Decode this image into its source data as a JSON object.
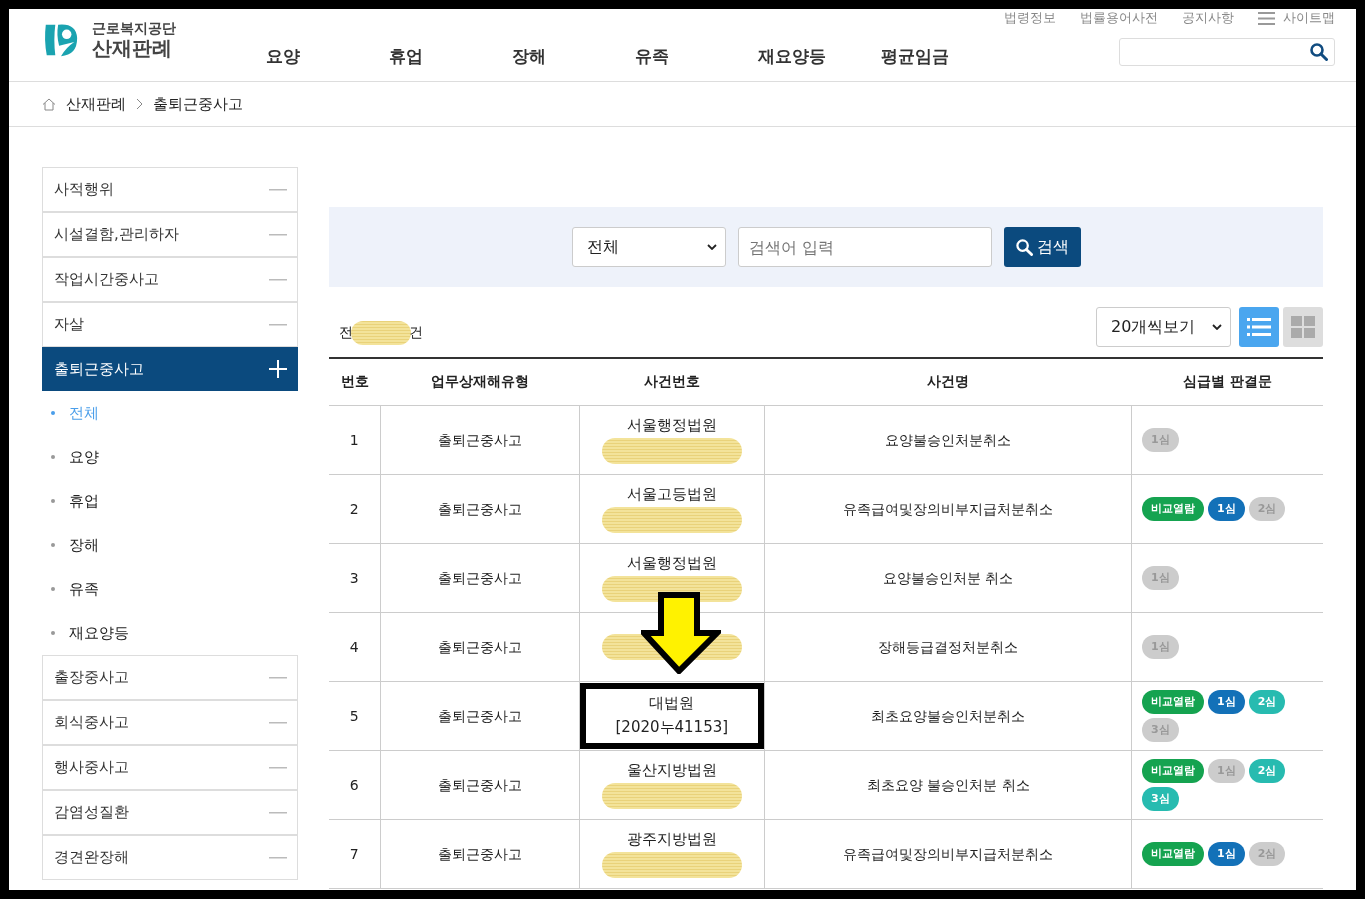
{
  "logo": {
    "org": "근로복지공단",
    "title": "산재판례"
  },
  "nav": [
    "요양",
    "휴업",
    "장해",
    "유족",
    "재요양등",
    "평균임금"
  ],
  "utility_links": [
    "법령정보",
    "법률용어사전",
    "공지사항"
  ],
  "sitemap": "사이트맵",
  "breadcrumb": [
    "산재판례",
    "출퇴근중사고"
  ],
  "sidebar": [
    {
      "label": "사적행위",
      "expanded": false
    },
    {
      "label": "시설결함,관리하자",
      "expanded": false
    },
    {
      "label": "작업시간중사고",
      "expanded": false
    },
    {
      "label": "자살",
      "expanded": false
    },
    {
      "label": "출퇴근중사고",
      "expanded": true,
      "children": [
        {
          "label": "전체",
          "selected": true
        },
        {
          "label": "요양",
          "selected": false
        },
        {
          "label": "휴업",
          "selected": false
        },
        {
          "label": "장해",
          "selected": false
        },
        {
          "label": "유족",
          "selected": false
        },
        {
          "label": "재요양등",
          "selected": false
        }
      ]
    },
    {
      "label": "출장중사고",
      "expanded": false
    },
    {
      "label": "회식중사고",
      "expanded": false
    },
    {
      "label": "행사중사고",
      "expanded": false
    },
    {
      "label": "감염성질환",
      "expanded": false
    },
    {
      "label": "경견완장해",
      "expanded": false
    }
  ],
  "search": {
    "scope": "전체",
    "placeholder": "검색어 입력",
    "button": "검색"
  },
  "total": {
    "prefix": "전",
    "suffix": "건"
  },
  "page_size": "20개씩보기",
  "view_modes": [
    {
      "kind": "list",
      "selected": true
    },
    {
      "kind": "grid",
      "selected": false
    }
  ],
  "table": {
    "columns": [
      "번호",
      "업무상재해유형",
      "사건번호",
      "사건명",
      "심급별 판결문"
    ],
    "rows": [
      {
        "no": "1",
        "type": "출퇴근중사고",
        "court": "서울행정법원",
        "case_no_redacted": true,
        "name": "요양불승인처분취소",
        "badges": [
          {
            "label": "1심",
            "color": "#cccccc",
            "disabled": true
          }
        ]
      },
      {
        "no": "2",
        "type": "출퇴근중사고",
        "court": "서울고등법원",
        "case_no_redacted": true,
        "name": "유족급여및장의비부지급처분취소",
        "badges": [
          {
            "label": "비교열람",
            "color": "#15a350",
            "disabled": false
          },
          {
            "label": "1심",
            "color": "#1371b8",
            "disabled": false
          },
          {
            "label": "2심",
            "color": "#cccccc",
            "disabled": true
          }
        ]
      },
      {
        "no": "3",
        "type": "출퇴근중사고",
        "court": "서울행정법원",
        "case_no_redacted": true,
        "name": "요양불승인처분 취소",
        "badges": [
          {
            "label": "1심",
            "color": "#cccccc",
            "disabled": true
          }
        ]
      },
      {
        "no": "4",
        "type": "출퇴근중사고",
        "case_no_redacted": true,
        "name": "장해등급결정처분취소",
        "badges": [
          {
            "label": "1심",
            "color": "#cccccc",
            "disabled": true
          }
        ]
      },
      {
        "no": "5",
        "type": "출퇴근중사고",
        "court": "대법원",
        "case_no": "[2020누41153]",
        "highlighted": true,
        "name": "최초요양불승인처분취소",
        "badges": [
          {
            "label": "비교열람",
            "color": "#15a350",
            "disabled": false
          },
          {
            "label": "1심",
            "color": "#1371b8",
            "disabled": false
          },
          {
            "label": "2심",
            "color": "#27bbb0",
            "disabled": false
          },
          {
            "label": "3심",
            "color": "#cccccc",
            "disabled": true
          }
        ]
      },
      {
        "no": "6",
        "type": "출퇴근중사고",
        "court": "울산지방법원",
        "case_no_redacted": true,
        "name": "최초요양 불승인처분 취소",
        "badges": [
          {
            "label": "비교열람",
            "color": "#15a350",
            "disabled": false
          },
          {
            "label": "1심",
            "color": "#cccccc",
            "disabled": true
          },
          {
            "label": "2심",
            "color": "#27bbb0",
            "disabled": false
          },
          {
            "label": "3심",
            "color": "#27bbb0",
            "disabled": false
          }
        ]
      },
      {
        "no": "7",
        "type": "출퇴근중사고",
        "court": "광주지방법원",
        "case_no_redacted": true,
        "name": "유족급여및장의비부지급처분취소",
        "badges": [
          {
            "label": "비교열람",
            "color": "#15a350",
            "disabled": false
          },
          {
            "label": "1심",
            "color": "#1371b8",
            "disabled": false
          },
          {
            "label": "2심",
            "color": "#cccccc",
            "disabled": true
          }
        ]
      }
    ]
  }
}
